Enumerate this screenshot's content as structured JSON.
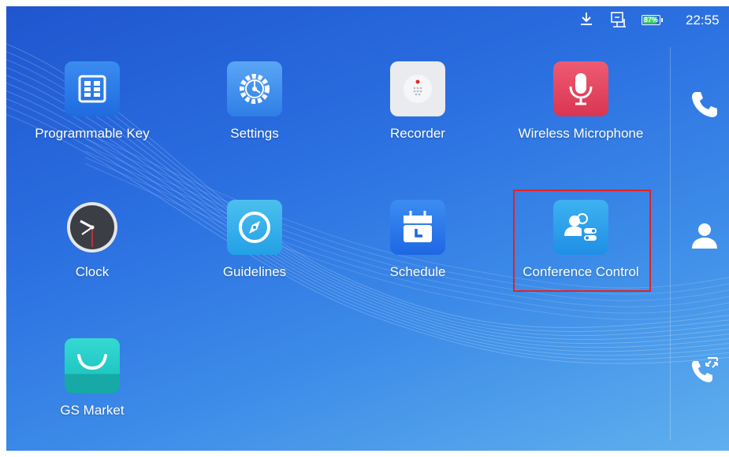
{
  "status_bar": {
    "icons": [
      "download-icon",
      "ethernet-icon",
      "battery-icon"
    ],
    "battery_text": "87%",
    "battery_level": 0.87,
    "battery_color": "#3ad16b",
    "time": "22:55"
  },
  "apps": [
    {
      "label": "Programmable Key",
      "icon": "programmable-key-icon"
    },
    {
      "label": "Settings",
      "icon": "gear-icon"
    },
    {
      "label": "Recorder",
      "icon": "recorder-icon"
    },
    {
      "label": "Wireless Microphone",
      "icon": "microphone-icon"
    },
    {
      "label": "Clock",
      "icon": "clock-icon"
    },
    {
      "label": "Guidelines",
      "icon": "compass-icon"
    },
    {
      "label": "Schedule",
      "icon": "calendar-icon"
    },
    {
      "label": "Conference Control",
      "icon": "conference-control-icon"
    },
    {
      "label": "GS Market",
      "icon": "shopping-bag-icon"
    }
  ],
  "side_buttons": [
    "phone-icon",
    "contact-icon",
    "call-history-icon"
  ],
  "highlight_color": "#e32222"
}
